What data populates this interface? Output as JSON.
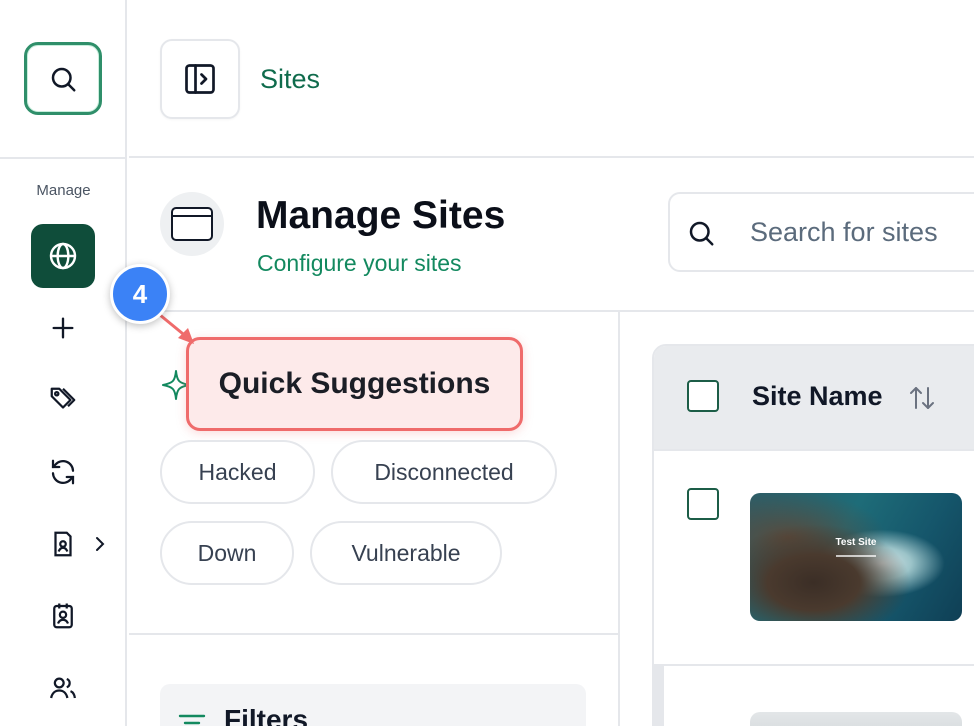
{
  "sidebar": {
    "section_label": "Manage",
    "items": [
      {
        "icon": "globe-icon",
        "active": true
      },
      {
        "icon": "plus-icon"
      },
      {
        "icon": "tags-icon"
      },
      {
        "icon": "refresh-icon"
      },
      {
        "icon": "report-icon",
        "has_submenu": true
      },
      {
        "icon": "contact-card-icon"
      },
      {
        "icon": "users-icon"
      }
    ]
  },
  "topbar": {
    "breadcrumb": "Sites"
  },
  "header": {
    "title": "Manage Sites",
    "subtitle": "Configure your sites",
    "search_placeholder": "Search for sites"
  },
  "suggestions": {
    "label": "Quick Suggestions",
    "chips": [
      "Hacked",
      "Disconnected",
      "Down",
      "Vulnerable"
    ]
  },
  "filters": {
    "label": "Filters"
  },
  "table": {
    "column_site_name": "Site Name",
    "rows": [
      {
        "thumbnail_title": "Test Site"
      }
    ]
  },
  "annotation": {
    "step_number": "4"
  },
  "colors": {
    "brand": "#0f4d3a",
    "accent_green": "#13895f",
    "highlight_border": "#ef6b6b",
    "step_badge": "#3b82f6"
  }
}
